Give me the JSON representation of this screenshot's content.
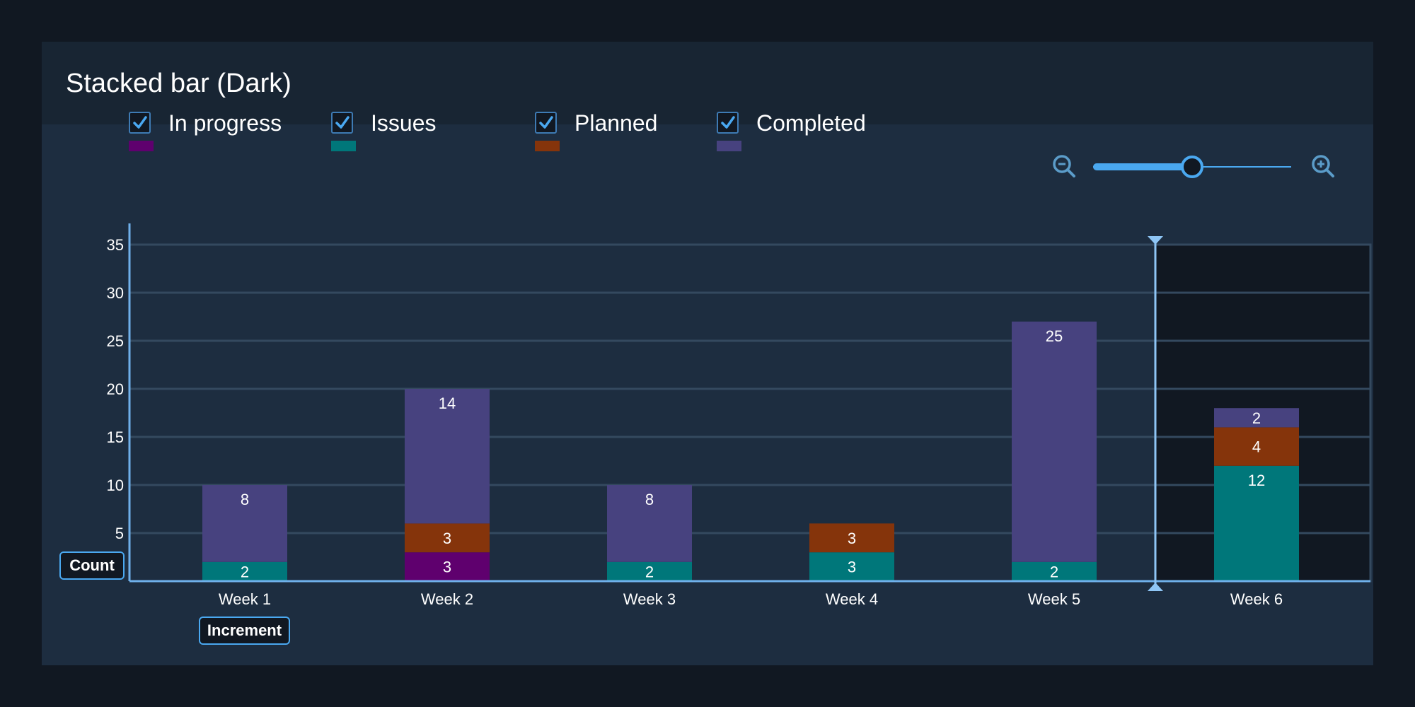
{
  "header": {
    "title": "Stacked bar (Dark)"
  },
  "legend": [
    {
      "label": "In progress",
      "checked": true,
      "color": "#5f006e"
    },
    {
      "label": "Issues",
      "checked": true,
      "color": "#00777a"
    },
    {
      "label": "Planned",
      "checked": true,
      "color": "#85340b"
    },
    {
      "label": "Completed",
      "checked": true,
      "color": "#47427f"
    }
  ],
  "zoom": {
    "zoom_out_icon": "zoom-out-icon",
    "zoom_in_icon": "zoom-in-icon",
    "level": 0.5
  },
  "axis_badges": {
    "y": "Count",
    "x": "Increment"
  },
  "colors": {
    "accent": "#4aa8f0",
    "marker": "#8ec5f5",
    "grid": "#34495f",
    "highlight_bg": "#111822"
  },
  "chart_data": {
    "type": "bar",
    "stacked": true,
    "title": "Stacked bar (Dark)",
    "xlabel": "Increment",
    "ylabel": "Count",
    "categories": [
      "Week 1",
      "Week 2",
      "Week 3",
      "Week 4",
      "Week 5",
      "Week 6"
    ],
    "series": [
      {
        "name": "In progress",
        "values": [
          0,
          3,
          0,
          0,
          0,
          0
        ]
      },
      {
        "name": "Issues",
        "values": [
          2,
          0,
          2,
          3,
          2,
          12
        ]
      },
      {
        "name": "Planned",
        "values": [
          0,
          3,
          0,
          3,
          0,
          4
        ]
      },
      {
        "name": "Completed",
        "values": [
          8,
          14,
          8,
          0,
          25,
          2
        ]
      }
    ],
    "yticks": [
      5,
      10,
      15,
      20,
      25,
      30,
      35
    ],
    "ylim": [
      0,
      36.6
    ],
    "grid": true,
    "legend_position": "top-left",
    "highlighted_category": "Week 6"
  }
}
